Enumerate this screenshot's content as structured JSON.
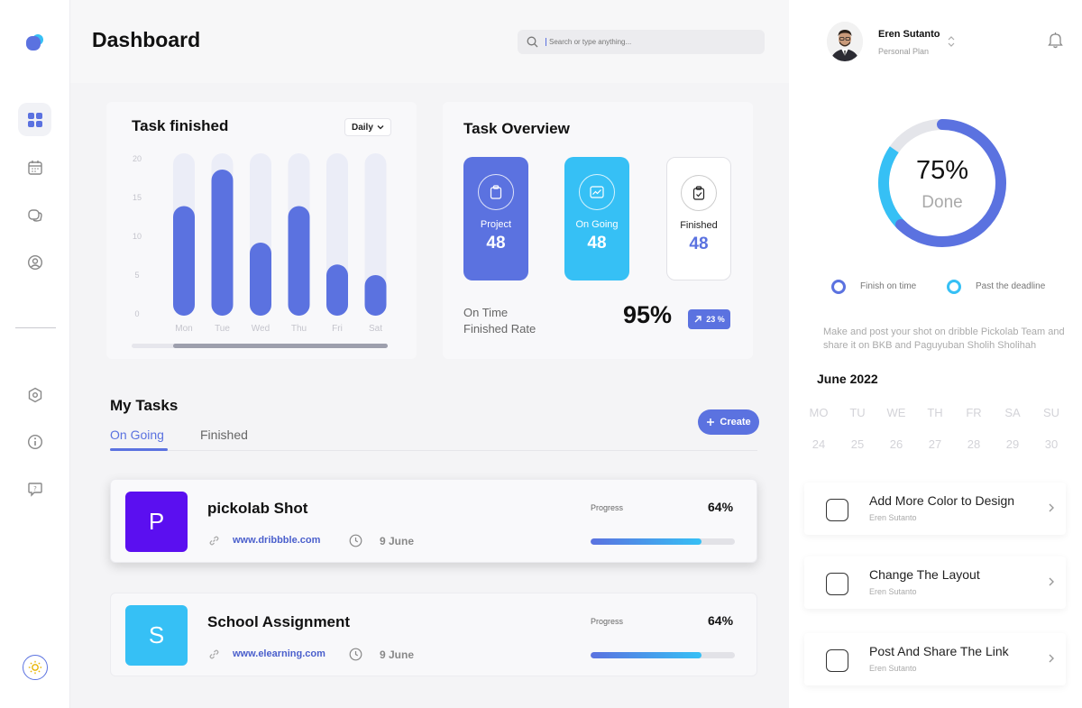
{
  "colors": {
    "accent": "#5b72e0",
    "cyan": "#36c0f5",
    "purple": "#5b0ff0"
  },
  "header": {
    "title": "Dashboard",
    "search_placeholder": "Search or type anything..."
  },
  "task_finished": {
    "title": "Task finished",
    "filter": "Daily"
  },
  "chart_data": {
    "type": "bar",
    "title": "Task finished",
    "categories": [
      "Mon",
      "Tue",
      "Wed",
      "Thu",
      "Fri",
      "Sat"
    ],
    "values": [
      13.5,
      18,
      9,
      13.5,
      6.3,
      5
    ],
    "yticks": [
      "20",
      "15",
      "10",
      "5",
      "0"
    ],
    "ylim": [
      0,
      20
    ]
  },
  "overview": {
    "title": "Task Overview",
    "tiles": [
      {
        "label": "Project",
        "value": "48"
      },
      {
        "label": "On Going",
        "value": "48"
      },
      {
        "label": "Finished",
        "value": "48"
      }
    ],
    "rate_label_1": "On Time",
    "rate_label_2": "Finished Rate",
    "rate_value": "95%",
    "rate_change": "23 %"
  },
  "my_tasks": {
    "title": "My Tasks",
    "tab_ongoing": "On Going",
    "tab_finished": "Finished",
    "create_label": "Create",
    "items": [
      {
        "letter": "P",
        "title": "pickolab Shot",
        "link": "www.dribbble.com",
        "date": "9 June",
        "progress_label": "Progress",
        "progress": "64%",
        "progress_fraction": 0.77
      },
      {
        "letter": "S",
        "title": "School Assignment",
        "link": "www.elearning.com",
        "date": "9 June",
        "progress_label": "Progress",
        "progress": "64%",
        "progress_fraction": 0.77
      }
    ]
  },
  "user": {
    "name": "Eren Sutanto",
    "plan": "Personal Plan"
  },
  "summary": {
    "value": "75%",
    "label": "Done",
    "done_fraction": 0.75,
    "legend_on_time": "Finish on time",
    "legend_deadline": "Past the deadline",
    "note": "Make and post your shot on dribble Pickolab Team and share it on BKB and Paguyuban Sholih Sholihah"
  },
  "calendar": {
    "month": "June 2022",
    "days": [
      "MO",
      "TU",
      "WE",
      "TH",
      "FR",
      "SA",
      "SU"
    ],
    "dates": [
      "24",
      "25",
      "26",
      "27",
      "28",
      "29",
      "30"
    ]
  },
  "todos": [
    {
      "title": "Add More Color to Design",
      "owner": "Eren Sutanto"
    },
    {
      "title": "Change The Layout",
      "owner": "Eren Sutanto"
    },
    {
      "title": "Post And Share The Link",
      "owner": "Eren Sutanto"
    }
  ]
}
